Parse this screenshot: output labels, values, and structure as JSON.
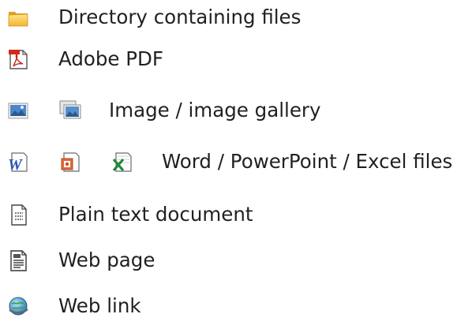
{
  "legend": {
    "items": [
      {
        "icons": [
          "folder-icon"
        ],
        "label": "Directory containing files"
      },
      {
        "icons": [
          "pdf-file-icon"
        ],
        "label": "Adobe PDF"
      },
      {
        "icons": [
          "image-file-icon",
          "image-gallery-icon"
        ],
        "label": "Image / image gallery"
      },
      {
        "icons": [
          "word-file-icon",
          "powerpoint-file-icon",
          "excel-file-icon"
        ],
        "label": "Word / PowerPoint / Excel files"
      },
      {
        "icons": [
          "text-document-icon"
        ],
        "label": "Plain text document"
      },
      {
        "icons": [
          "web-page-icon"
        ],
        "label": "Web page"
      },
      {
        "icons": [
          "web-link-icon"
        ],
        "label": "Web link"
      }
    ]
  }
}
